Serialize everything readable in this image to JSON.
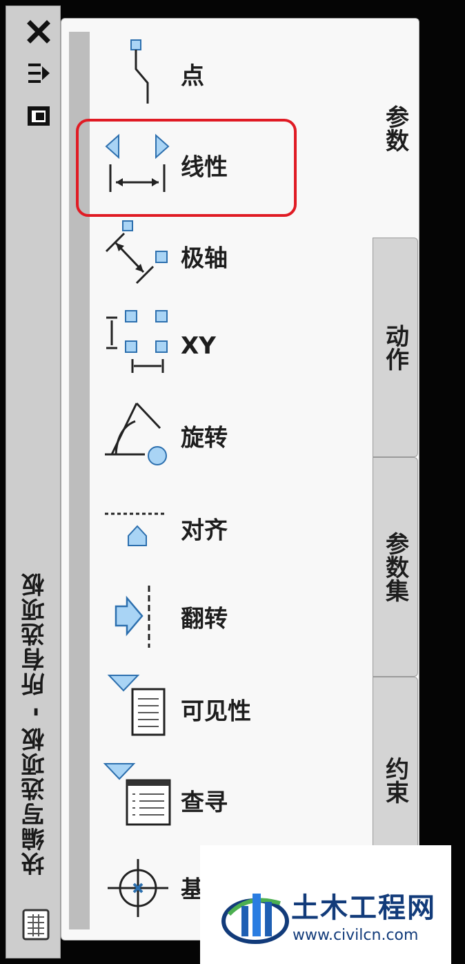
{
  "window": {
    "title": "块编写选项板 - 所有选项板"
  },
  "tools": [
    {
      "label": "点",
      "icon": "point-parameter-icon"
    },
    {
      "label": "线性",
      "icon": "linear-parameter-icon"
    },
    {
      "label": "极轴",
      "icon": "polar-parameter-icon"
    },
    {
      "label": "XY",
      "icon": "xy-parameter-icon"
    },
    {
      "label": "旋转",
      "icon": "rotation-parameter-icon"
    },
    {
      "label": "对齐",
      "icon": "alignment-parameter-icon"
    },
    {
      "label": "翻转",
      "icon": "flip-parameter-icon"
    },
    {
      "label": "可见性",
      "icon": "visibility-parameter-icon"
    },
    {
      "label": "查寻",
      "icon": "lookup-parameter-icon"
    },
    {
      "label": "基",
      "icon": "basepoint-parameter-icon"
    }
  ],
  "tabs": [
    {
      "label": "参数",
      "active": true
    },
    {
      "label": "动作",
      "active": false
    },
    {
      "label": "参数集",
      "active": false
    },
    {
      "label": "约束",
      "active": false
    }
  ],
  "highlighted_tool": "线性",
  "watermark": {
    "name": "土木工程网",
    "url": "www.civilcn.com"
  },
  "colors": {
    "highlight": "#e01b24",
    "grip_fill": "#a9d4f5",
    "grip_stroke": "#2c6fae",
    "panel_bg": "#f8f8f8",
    "tab_bg": "#d4d4d4",
    "watermark_text": "#123b7a"
  }
}
